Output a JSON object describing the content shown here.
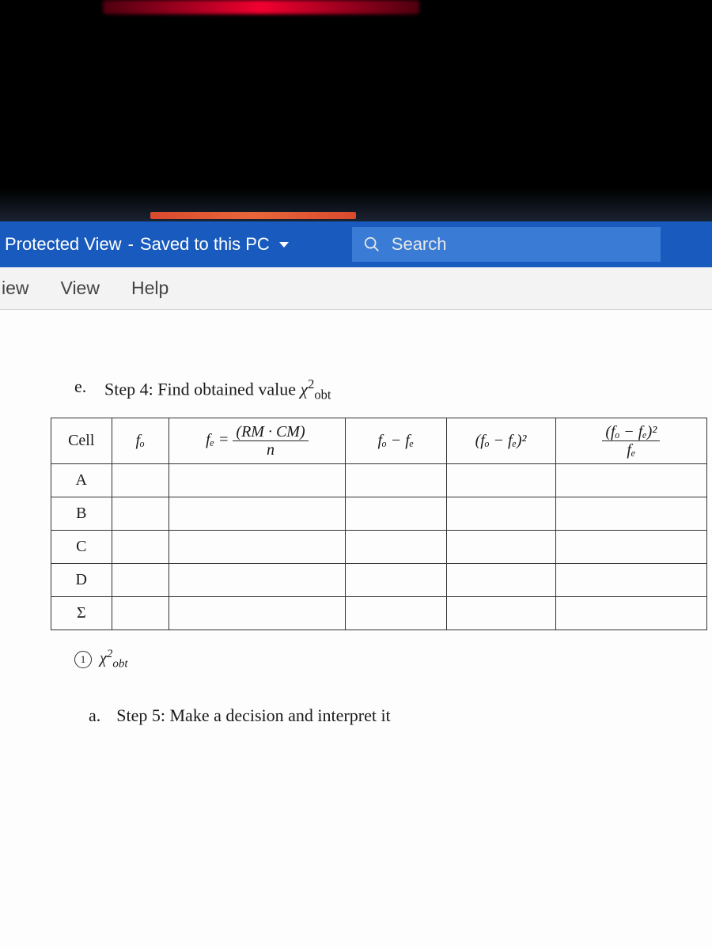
{
  "titlebar": {
    "mode": "Protected View",
    "separator": "-",
    "status": "Saved to this PC"
  },
  "search": {
    "placeholder": "Search"
  },
  "ribbon": {
    "tabs": [
      "iew",
      "View",
      "Help"
    ]
  },
  "content": {
    "step4_marker": "e.",
    "step4_text_prefix": "Step 4: Find obtained value ",
    "chi_symbol": "χ",
    "chi_sup": "2",
    "chi_sub": "obt",
    "table": {
      "headers": {
        "cell": "Cell",
        "fo": "fₒ",
        "fe_lhs": "fₑ =",
        "fe_num": "(RM · CM)",
        "fe_den": "n",
        "diff": "fₒ − fₑ",
        "sq": "(fₒ − fₑ)²",
        "ratio_num": "(fₒ − fₑ)²",
        "ratio_den": "fₑ"
      },
      "rows": [
        "A",
        "B",
        "C",
        "D"
      ],
      "sigma": "Σ"
    },
    "chi_obt_marker": "①",
    "chi_obt_label": "χ²obt",
    "step5_marker": "a.",
    "step5_text": "Step 5: Make a decision and interpret it"
  }
}
